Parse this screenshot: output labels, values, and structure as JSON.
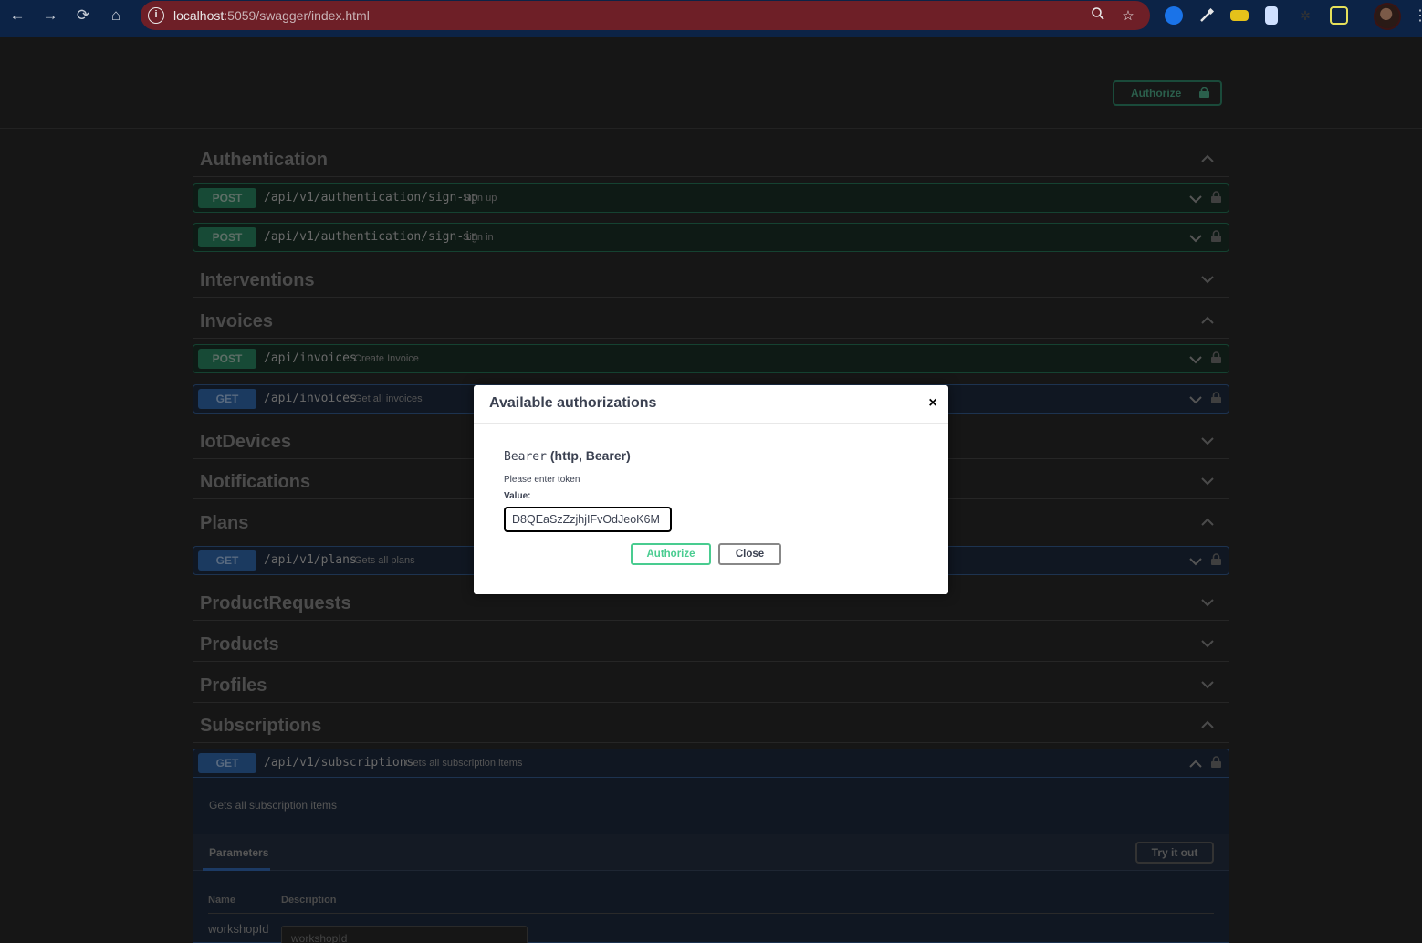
{
  "browser": {
    "url_host": "localhost",
    "url_rest": ":5059/swagger/index.html"
  },
  "header": {
    "authorize_label": "Authorize"
  },
  "tags": {
    "authentication": "Authentication",
    "interventions": "Interventions",
    "invoices": "Invoices",
    "iotdevices": "IotDevices",
    "notifications": "Notifications",
    "plans": "Plans",
    "productrequests": "ProductRequests",
    "products": "Products",
    "profiles": "Profiles",
    "subscriptions": "Subscriptions"
  },
  "operations": {
    "signup": {
      "method": "POST",
      "path": "/api/v1/authentication/sign-up",
      "summary": "Sign up"
    },
    "signin": {
      "method": "POST",
      "path": "/api/v1/authentication/sign-in",
      "summary": "Sign in"
    },
    "create_invoice": {
      "method": "POST",
      "path": "/api/invoices",
      "summary": "Create Invoice"
    },
    "get_invoices": {
      "method": "GET",
      "path": "/api/invoices",
      "summary": "Get all invoices"
    },
    "get_plans": {
      "method": "GET",
      "path": "/api/v1/plans",
      "summary": "Gets all plans"
    },
    "get_subscriptions": {
      "method": "GET",
      "path": "/api/v1/subscriptions",
      "summary": "Gets all subscription items"
    }
  },
  "subscriptions_body": {
    "description": "Gets all subscription items",
    "parameters_tab": "Parameters",
    "try_it_out": "Try it out",
    "col_name": "Name",
    "col_description": "Description",
    "param_name": "workshopId",
    "param_placeholder": "workshopId"
  },
  "modal": {
    "title": "Available authorizations",
    "close_symbol": "×",
    "scheme_name": "Bearer",
    "scheme_type": "(http, Bearer)",
    "hint": "Please enter token",
    "value_label": "Value:",
    "token_value": "D8QEaSzZzjhjIFvOdJeoK6M",
    "authorize_label": "Authorize",
    "close_label": "Close"
  },
  "colors": {
    "post_accent": "#49cc90",
    "get_accent": "#61affe",
    "browser_frame": "#0c2346",
    "omnibox": "#6e1f27"
  },
  "icons": [
    "back-arrow-icon",
    "forward-arrow-icon",
    "reload-icon",
    "home-icon",
    "info-icon",
    "zoom-icon",
    "star-icon",
    "lock-icon",
    "chevron-up-icon",
    "chevron-down-icon",
    "close-icon"
  ]
}
